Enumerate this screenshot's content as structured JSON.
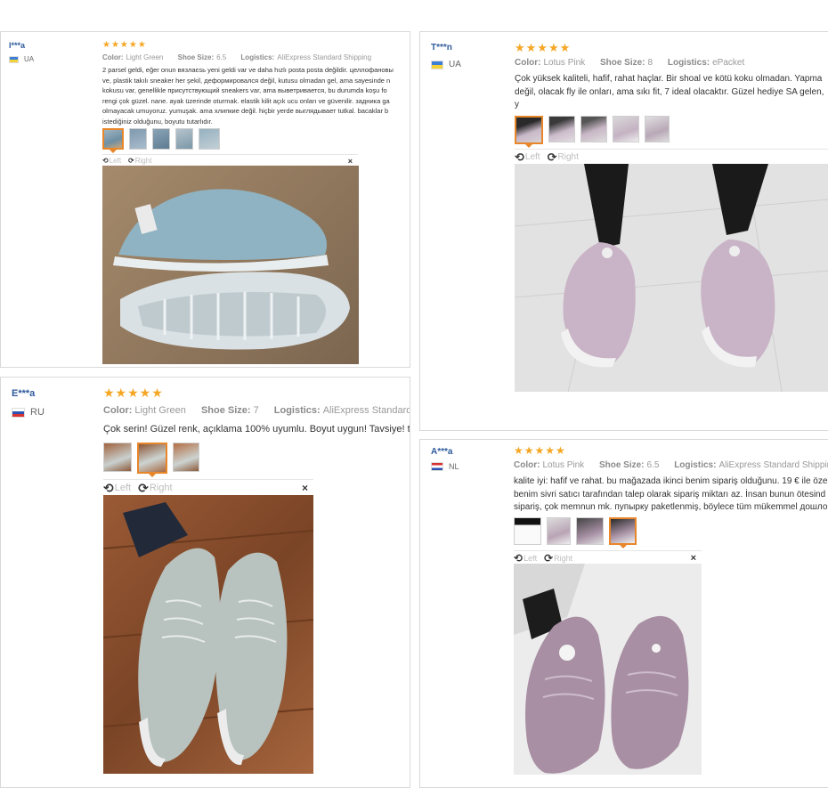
{
  "labels": {
    "color": "Color:",
    "size": "Shoe Size:",
    "logistics": "Logistics:",
    "left": "Left",
    "right": "Right",
    "close": "×"
  },
  "reviews": [
    {
      "user": "I***a",
      "country": "UA",
      "stars": "★★★★★",
      "color": "Light Green",
      "size": "6.5",
      "logistics": "AliExpress Standard Shipping",
      "text": "2 parsel geldi, eğer onun вязлаєsь yeni geldi var ve daha hızlı posta posta değildir. целлофановы\nve, plastik takılı sneaker her şekil, деформировался değil, kutusu olmadan gel, ama sayesinde n\nkokusu var, genellikle присутствующий sneakers var, ama выветривается, bu durumda koşu fo\nrengi çok güzel. nane. ayak üzerinde oturmak. elastik kilit açık ucu onları ve güvenilir. задника ga\nolmayacak umuyoruz. yumuşak. ama хлипкие değil. hiçbir yerde выглядывает tutkal. bacaklar b\nistediğiniz olduğunu, boyutu tutarlıdır."
    },
    {
      "user": "T***n",
      "country": "UA",
      "stars": "★★★★★",
      "color": "Lotus Pink",
      "size": "8",
      "logistics": "ePacket",
      "text": "Çok yüksek kaliteli, hafif, rahat haçlar. Bir shoal ve kötü koku olmadan. Yapma\ndeğil, olacak fly ile onları, ama sıkı fit, 7 ideal olacaktır. Güzel hediye SA gelen, y\niçin-bir öneri"
    },
    {
      "user": "E***a",
      "country": "RU",
      "stars": "★★★★★",
      "color": "Light Green",
      "size": "7",
      "logistics": "AliExpress Standard Shipping",
      "text": "Çok serin! Güzel renk, açıklama 100% uyumlu. Boyut uygun! Tavsiye! t"
    },
    {
      "user": "A***a",
      "country": "NL",
      "stars": "★★★★★",
      "color": "Lotus Pink",
      "size": "6.5",
      "logistics": "AliExpress Standard Shipping",
      "text": "kalite iyi: hafif ve rahat. bu mağazada ikinci benim sipariş olduğunu. 19 € ile öze\nbenim sivri satıcı tarafından talep olarak sipariş miktarı az. İnsan bunun ötesind\nsipariş, çok memnun mk. пупырку paketlenmiş, böylece tüm mükemmel дошло"
    }
  ],
  "colors": {
    "user": "#2d5a9b",
    "star": "#f5a623",
    "accent": "#e8862a",
    "meta": "#999999"
  }
}
